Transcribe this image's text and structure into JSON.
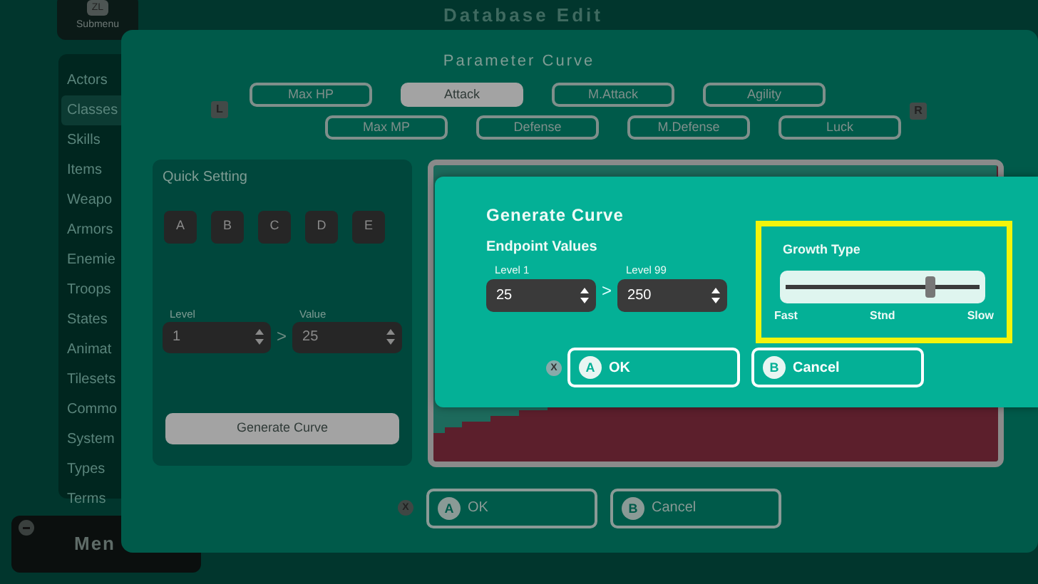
{
  "background": {
    "submenu_button": {
      "key": "ZL",
      "label": "Submenu"
    },
    "title": "Database Edit",
    "sidebar": {
      "items": [
        {
          "label": "Actors",
          "selected": false
        },
        {
          "label": "Classes",
          "selected": true
        },
        {
          "label": "Skills",
          "selected": false
        },
        {
          "label": "Items",
          "selected": false
        },
        {
          "label": "Weapo",
          "selected": false
        },
        {
          "label": "Armors",
          "selected": false
        },
        {
          "label": "Enemie",
          "selected": false
        },
        {
          "label": "Troops",
          "selected": false
        },
        {
          "label": "States",
          "selected": false
        },
        {
          "label": "Animat",
          "selected": false
        },
        {
          "label": "Tilesets",
          "selected": false
        },
        {
          "label": "Commo",
          "selected": false
        },
        {
          "label": "System",
          "selected": false
        },
        {
          "label": "Types",
          "selected": false
        },
        {
          "label": "Terms",
          "selected": false
        }
      ]
    },
    "menu_button": {
      "label": "Men"
    }
  },
  "parameter_curve": {
    "title": "Parameter Curve",
    "shoulder_left": "L",
    "shoulder_right": "R",
    "tab_rows": [
      [
        {
          "label": "Max HP",
          "selected": false
        },
        {
          "label": "Attack",
          "selected": true
        },
        {
          "label": "M.Attack",
          "selected": false
        },
        {
          "label": "Agility",
          "selected": false
        }
      ],
      [
        {
          "label": "Max MP",
          "selected": false
        },
        {
          "label": "Defense",
          "selected": false
        },
        {
          "label": "M.Defense",
          "selected": false
        },
        {
          "label": "Luck",
          "selected": false
        }
      ]
    ],
    "quick_setting": {
      "title": "Quick Setting",
      "presets": [
        "A",
        "B",
        "C",
        "D",
        "E"
      ],
      "level_label": "Level",
      "level": "1",
      "separator": ">",
      "value_label": "Value",
      "value": "25",
      "button": "Generate Curve"
    },
    "close_key": "X",
    "buttons": [
      {
        "key": "A",
        "label": "OK"
      },
      {
        "key": "B",
        "label": "Cancel"
      }
    ]
  },
  "generate_curve": {
    "title": "Generate Curve",
    "endpoint_label": "Endpoint Values",
    "separator": ">",
    "endpoints": [
      {
        "label": "Level 1",
        "value": "25"
      },
      {
        "label": "Level 99",
        "value": "250"
      }
    ],
    "growth_type": {
      "label": "Growth Type",
      "highlighted": true,
      "level": 0.74,
      "ticks": [
        "Fast",
        "Stnd",
        "Slow"
      ]
    },
    "close_key": "X",
    "buttons": [
      {
        "key": "A",
        "label": "OK"
      },
      {
        "key": "B",
        "label": "Cancel"
      }
    ]
  }
}
